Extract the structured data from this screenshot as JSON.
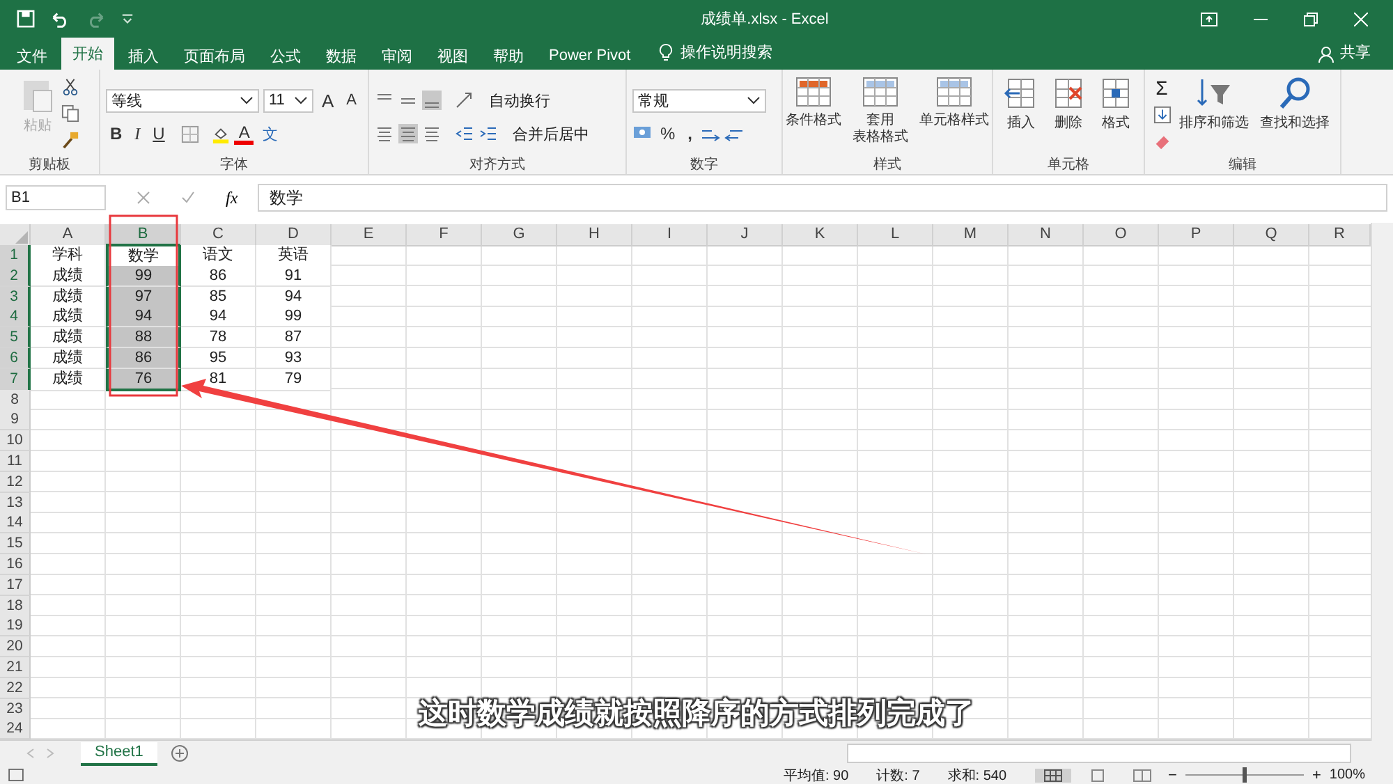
{
  "window": {
    "title": "成绩单.xlsx  -  Excel"
  },
  "menu_tabs": [
    {
      "label": "文件",
      "selected": false
    },
    {
      "label": "开始",
      "selected": true
    },
    {
      "label": "插入",
      "selected": false
    },
    {
      "label": "页面布局",
      "selected": false
    },
    {
      "label": "公式",
      "selected": false
    },
    {
      "label": "数据",
      "selected": false
    },
    {
      "label": "审阅",
      "selected": false
    },
    {
      "label": "视图",
      "selected": false
    },
    {
      "label": "帮助",
      "selected": false
    },
    {
      "label": "Power Pivot",
      "selected": false
    }
  ],
  "tell_me": "操作说明搜索",
  "share": "共享",
  "ribbon": {
    "clipboard": {
      "title": "剪贴板",
      "paste": "粘贴",
      "paste_disabled": true
    },
    "font": {
      "title": "字体",
      "font_name": "等线",
      "font_size": "11",
      "grow": "A",
      "shrink": "A",
      "bold": "B",
      "italic": "I",
      "underline": "U",
      "font_color": "A",
      "phonetic": "文"
    },
    "alignment": {
      "title": "对齐方式",
      "wrap_text": "自动换行",
      "merge_center": "合并后居中"
    },
    "number": {
      "title": "数字",
      "format": "常规",
      "percent": "%",
      "comma": ","
    },
    "styles": {
      "title": "样式",
      "buttons": [
        [
          "条件格式"
        ],
        [
          "套用",
          "表格格式"
        ],
        [
          "单元格样式"
        ]
      ]
    },
    "cells": {
      "title": "单元格",
      "buttons": [
        "插入",
        "删除",
        "格式"
      ]
    },
    "editing": {
      "title": "编辑",
      "sum": "Σ",
      "buttons": [
        "排序和筛选",
        "查找和选择"
      ]
    }
  },
  "formula_bar": {
    "name_box": "B1",
    "fx": "fx",
    "formula": "数学"
  },
  "columns": [
    {
      "label": "A",
      "selected": false
    },
    {
      "label": "B",
      "selected": true
    },
    {
      "label": "C",
      "selected": false
    },
    {
      "label": "D",
      "selected": false
    },
    {
      "label": "E",
      "selected": false
    },
    {
      "label": "F",
      "selected": false
    },
    {
      "label": "G",
      "selected": false
    },
    {
      "label": "H",
      "selected": false
    },
    {
      "label": "I",
      "selected": false
    },
    {
      "label": "J",
      "selected": false
    },
    {
      "label": "K",
      "selected": false
    },
    {
      "label": "L",
      "selected": false
    },
    {
      "label": "M",
      "selected": false
    },
    {
      "label": "N",
      "selected": false
    },
    {
      "label": "O",
      "selected": false
    },
    {
      "label": "P",
      "selected": false
    },
    {
      "label": "Q",
      "selected": false
    },
    {
      "label": "R",
      "selected": false
    }
  ],
  "rows": [
    {
      "number": "1",
      "selected": true,
      "cells": [
        "学科",
        "数学",
        "语文",
        "英语"
      ]
    },
    {
      "number": "2",
      "selected": true,
      "cells": [
        "成绩",
        "99",
        "86",
        "91"
      ]
    },
    {
      "number": "3",
      "selected": true,
      "cells": [
        "成绩",
        "97",
        "85",
        "94"
      ]
    },
    {
      "number": "4",
      "selected": true,
      "cells": [
        "成绩",
        "94",
        "94",
        "99"
      ]
    },
    {
      "number": "5",
      "selected": true,
      "cells": [
        "成绩",
        "88",
        "78",
        "87"
      ]
    },
    {
      "number": "6",
      "selected": true,
      "cells": [
        "成绩",
        "86",
        "95",
        "93"
      ]
    },
    {
      "number": "7",
      "selected": true,
      "cells": [
        "成绩",
        "76",
        "81",
        "79"
      ]
    },
    {
      "number": "8",
      "selected": false
    },
    {
      "number": "9",
      "selected": false
    },
    {
      "number": "10",
      "selected": false
    },
    {
      "number": "11",
      "selected": false
    },
    {
      "number": "12",
      "selected": false
    },
    {
      "number": "13",
      "selected": false
    },
    {
      "number": "14",
      "selected": false
    },
    {
      "number": "15",
      "selected": false
    },
    {
      "number": "16",
      "selected": false
    },
    {
      "number": "17",
      "selected": false
    },
    {
      "number": "18",
      "selected": false
    },
    {
      "number": "19",
      "selected": false
    },
    {
      "number": "20",
      "selected": false
    },
    {
      "number": "21",
      "selected": false
    },
    {
      "number": "22",
      "selected": false
    },
    {
      "number": "23",
      "selected": false
    },
    {
      "number": "24",
      "selected": false
    }
  ],
  "sheet_tabs": [
    {
      "label": "Sheet1",
      "selected": true
    }
  ],
  "status_bar": {
    "average": "平均值: 90",
    "count": "计数: 7",
    "sum": "求和: 540",
    "zoom_out": "−",
    "zoom_in": "+",
    "zoom": {
      "level": 0.5
    },
    "zoom_text": "100%"
  },
  "caption": "这时数学成绩就按照降序的方式排列完成了"
}
